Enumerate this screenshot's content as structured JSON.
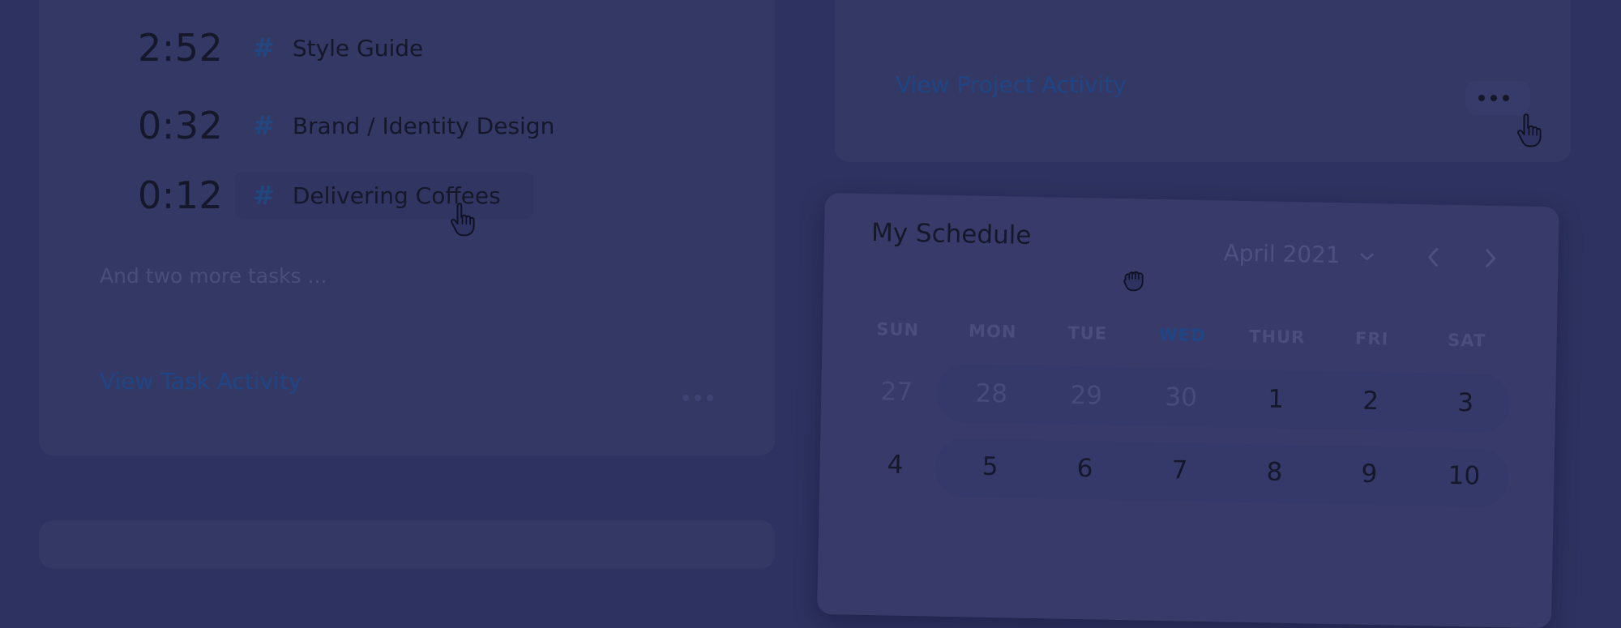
{
  "task_card": {
    "tasks": [
      {
        "time": "2:52",
        "name": "Style Guide"
      },
      {
        "time": "0:32",
        "name": "Brand / Identity Design"
      },
      {
        "time": "0:12",
        "name": "Delivering Coffees"
      }
    ],
    "more_tasks_text": "And two more tasks ...",
    "view_link": "View Task Activity"
  },
  "project_card": {
    "view_link": "View Project Activity"
  },
  "schedule": {
    "title": "My Schedule",
    "month_label": "April 2021",
    "weekdays": [
      "SUN",
      "MON",
      "TUE",
      "WED",
      "THUR",
      "FRI",
      "SAT"
    ],
    "highlighted_weekday": "WED",
    "weeks": [
      [
        "27",
        "28",
        "29",
        "30",
        "1",
        "2",
        "3"
      ],
      [
        "4",
        "5",
        "6",
        "7",
        "8",
        "9",
        "10"
      ]
    ]
  },
  "colors": {
    "overlay_background": "#2e3260",
    "link": "#1f4585",
    "hash": "#23467f"
  },
  "icons": {
    "hash": "#",
    "dropdown": "chevron-down-icon",
    "prev": "chevron-left-icon",
    "next": "chevron-right-icon",
    "more": "more-horizontal-icon",
    "pointer": "hand-pointer-cursor",
    "grab": "hand-grab-cursor"
  }
}
